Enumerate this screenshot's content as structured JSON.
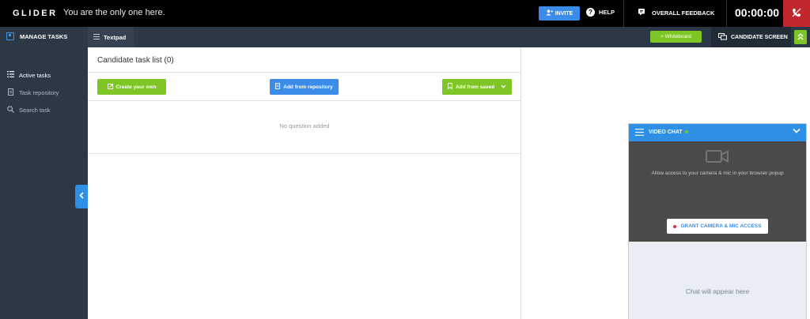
{
  "topbar": {
    "logo": "GLIDER",
    "status": "You are the only one here.",
    "invite_label": "INVITE",
    "help_label": "HELP",
    "feedback_label": "OVERALL FEEDBACK",
    "timer": "00:00:00"
  },
  "subbar": {
    "manage_tasks": "MANAGE TASKS",
    "textpad": "Textpad",
    "whiteboard": "+ Whiteboard",
    "candidate_screen": "CANDIDATE SCREEN"
  },
  "sidebar": {
    "items": [
      {
        "label": "Active tasks",
        "icon": "list-icon",
        "active": true
      },
      {
        "label": "Task repository",
        "icon": "document-icon",
        "active": false
      },
      {
        "label": "Search task",
        "icon": "search-icon",
        "active": false
      }
    ]
  },
  "tasks": {
    "title": "Candidate task list (0)",
    "create_own": "Create your own",
    "add_repo": "Add from repository",
    "add_saved": "Add from saved",
    "empty": "No question added"
  },
  "video_chat": {
    "title": "VIDEO CHAT",
    "allow_text": "Allow access to your camera & mic in your browser popup",
    "grant_label": "GRANT CAMERA & MIC ACCESS",
    "chat_placeholder": "Chat will appear here"
  },
  "colors": {
    "accent_blue": "#3b8be8",
    "accent_green": "#7ec625",
    "end_call_red": "#c0282d",
    "sidebar_bg": "#2c3846"
  }
}
